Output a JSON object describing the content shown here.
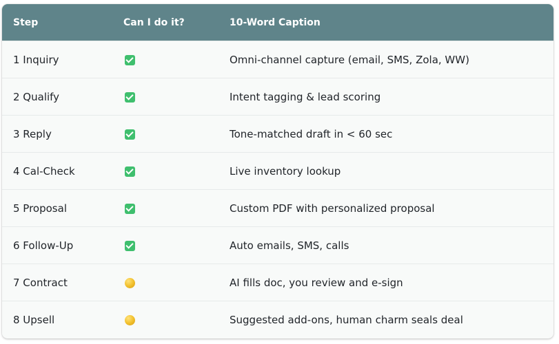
{
  "table": {
    "headers": [
      "Step",
      "Can I do it?",
      "10-Word Caption"
    ],
    "rows": [
      {
        "step": "1 Inquiry",
        "status": "check-icon",
        "caption": "Omni-channel capture (email, SMS, Zola, WW)"
      },
      {
        "step": "2 Qualify",
        "status": "check-icon",
        "caption": "Intent tagging & lead scoring"
      },
      {
        "step": "3 Reply",
        "status": "check-icon",
        "caption": "Tone-matched draft in < 60 sec"
      },
      {
        "step": "4 Cal-Check",
        "status": "check-icon",
        "caption": "Live inventory lookup"
      },
      {
        "step": "5 Proposal",
        "status": "check-icon",
        "caption": "Custom PDF with personalized proposal"
      },
      {
        "step": "6 Follow-Up",
        "status": "check-icon",
        "caption": "Auto emails, SMS, calls"
      },
      {
        "step": "7 Contract",
        "status": "yellow-circle-icon",
        "caption": "AI fills doc, you review and e-sign"
      },
      {
        "step": "8 Upsell",
        "status": "yellow-circle-icon",
        "caption": "Suggested add-ons, human charm seals deal"
      }
    ]
  },
  "colors": {
    "header_bg": "#5f848a",
    "check_green": "#3fbf6e",
    "circle_yellow": "#f2c12e"
  }
}
